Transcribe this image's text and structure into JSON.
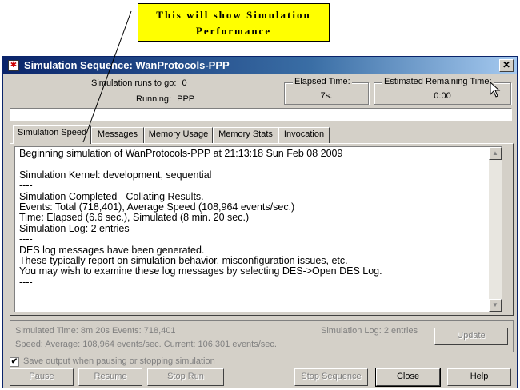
{
  "callout": {
    "line1": "This will show Simulation",
    "line2": "Performance"
  },
  "window": {
    "title": "Simulation Sequence: WanProtocols-PPP",
    "close_symbol": "✕",
    "icon": "app-icon"
  },
  "header": {
    "runs_label": "Simulation runs to go:",
    "runs_value": "0",
    "running_label": "Running:",
    "running_value": "PPP",
    "elapsed_title": "Elapsed Time:",
    "elapsed_value": "7s.",
    "remaining_title": "Estimated Remaining Time:",
    "remaining_value": "0:00"
  },
  "progress": {
    "fraction": 0.0
  },
  "tabs": [
    {
      "label": "Simulation Speed"
    },
    {
      "label": "Messages"
    },
    {
      "label": "Memory Usage"
    },
    {
      "label": "Memory Stats"
    },
    {
      "label": "Invocation"
    }
  ],
  "log": {
    "text": "Beginning simulation of WanProtocols-PPP at 21:13:18 Sun Feb 08 2009\n\nSimulation Kernel: development, sequential\n----\nSimulation Completed - Collating Results.\nEvents: Total (718,401), Average Speed (108,964 events/sec.)\nTime: Elapsed (6.6 sec.), Simulated (8 min. 20 sec.)\nSimulation Log: 2 entries\n----\nDES log messages have been generated.\nThese typically report on simulation behavior, misconfiguration issues, etc.\nYou may wish to examine these log messages by selecting DES->Open DES Log.\n----"
  },
  "status": {
    "simulated_time": "Simulated Time:  8m 20s  Events:  718,401",
    "speed": "Speed: Average:  108,964  events/sec. Current:  106,301  events/sec.",
    "sim_log": "Simulation Log: 2 entries",
    "update_label": "Update"
  },
  "options": {
    "save_output_label": "Save output when pausing or stopping simulation",
    "save_output_checked": true,
    "check_mark": "✔"
  },
  "buttons": {
    "pause": "Pause",
    "resume": "Resume",
    "stop_run": "Stop Run",
    "stop_sequence": "Stop Sequence",
    "close": "Close",
    "help": "Help"
  },
  "colors": {
    "titlebar": "#0a246a",
    "callout": "#ffff00",
    "dialog": "#d4d0c8"
  }
}
